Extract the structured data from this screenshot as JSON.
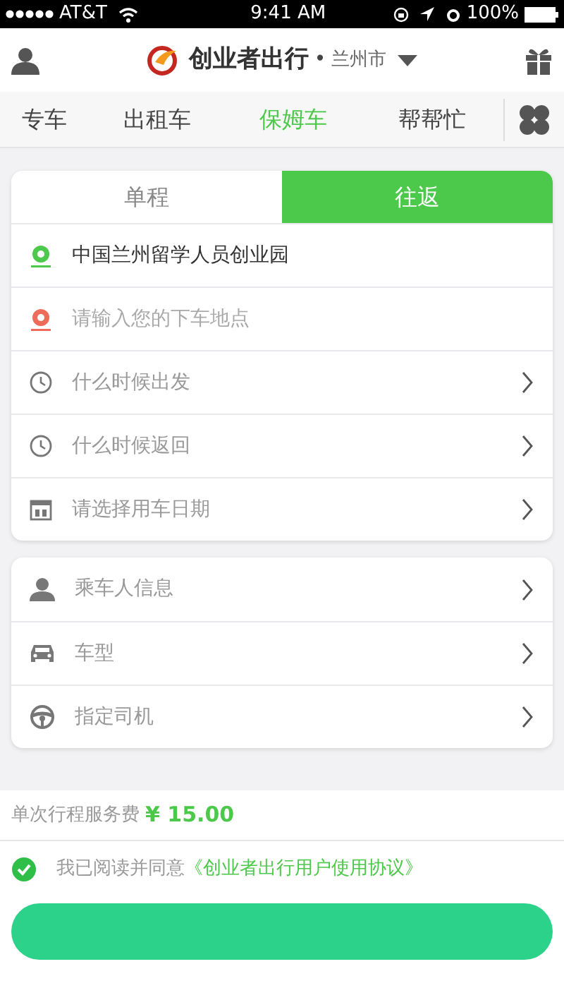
{
  "status_bar": {
    "carrier": "AT&T",
    "time": "9:41 AM",
    "battery": "100%"
  },
  "header": {
    "brand": "创业者出行",
    "separator": "•",
    "city": "兰州市"
  },
  "nav_tabs": [
    {
      "label": "专车",
      "selected": false
    },
    {
      "label": "出租车",
      "selected": false
    },
    {
      "label": "保姆车",
      "selected": true
    },
    {
      "label": "帮帮忙",
      "selected": false
    }
  ],
  "trip_segments": [
    {
      "label": "单程",
      "selected": false
    },
    {
      "label": "往返",
      "selected": true
    }
  ],
  "route_fields": [
    {
      "kind": "pickup",
      "value": "中国兰州留学人员创业园"
    },
    {
      "kind": "dropoff",
      "placeholder": "请输入您的下车地点"
    },
    {
      "kind": "time",
      "label": "什么时候出发"
    },
    {
      "kind": "time",
      "label": "什么时候返回"
    },
    {
      "kind": "date",
      "label": "请选择用车日期"
    }
  ],
  "detail_rows": [
    {
      "kind": "passenger",
      "label": "乘车人信息"
    },
    {
      "kind": "car",
      "label": "车型"
    },
    {
      "kind": "driver",
      "label": "指定司机"
    }
  ],
  "fee": {
    "label": "单次行程服务费",
    "amount": "¥ 15.00"
  },
  "agreement": {
    "checked": true,
    "text": "我已阅读并同意",
    "link": "《创业者出行用户使用协议》"
  }
}
